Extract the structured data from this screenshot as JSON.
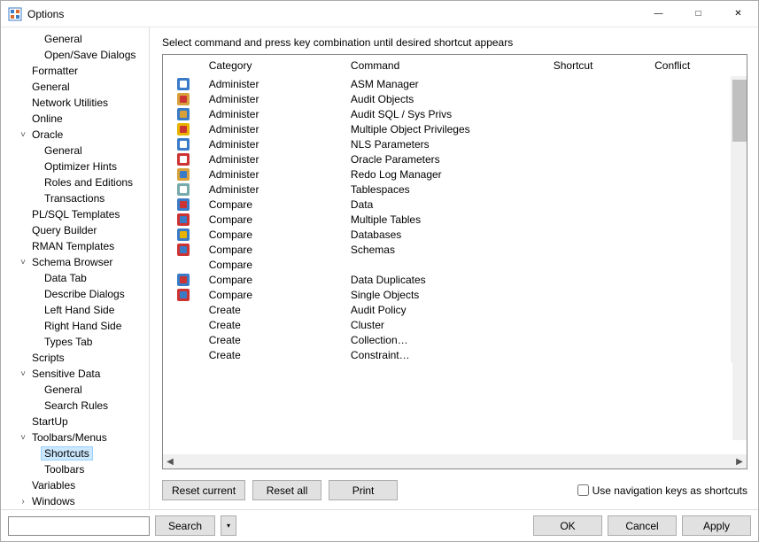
{
  "window": {
    "title": "Options"
  },
  "instruction": "Select command and press key combination until desired shortcut appears",
  "columns": {
    "category": "Category",
    "command": "Command",
    "shortcut": "Shortcut",
    "conflict": "Conflict"
  },
  "rows": [
    {
      "category": "Administer",
      "command": "ASM Manager",
      "icon": "asm"
    },
    {
      "category": "Administer",
      "command": "Audit Objects",
      "icon": "audit"
    },
    {
      "category": "Administer",
      "command": "Audit SQL / Sys Privs",
      "icon": "auditsql"
    },
    {
      "category": "Administer",
      "command": "Multiple Object Privileges",
      "icon": "star"
    },
    {
      "category": "Administer",
      "command": "NLS Parameters",
      "icon": "nls"
    },
    {
      "category": "Administer",
      "command": "Oracle Parameters",
      "icon": "ora"
    },
    {
      "category": "Administer",
      "command": "Redo Log Manager",
      "icon": "redo"
    },
    {
      "category": "Administer",
      "command": "Tablespaces",
      "icon": "ts"
    },
    {
      "category": "Compare",
      "command": "Data",
      "icon": "cmp"
    },
    {
      "category": "Compare",
      "command": "Multiple Tables",
      "icon": "cmp2"
    },
    {
      "category": "Compare",
      "command": "Databases",
      "icon": "cmpdb"
    },
    {
      "category": "Compare",
      "command": "Schemas",
      "icon": "cmps"
    },
    {
      "category": "Compare",
      "command": "",
      "icon": ""
    },
    {
      "category": "Compare",
      "command": "Data Duplicates",
      "icon": "dup"
    },
    {
      "category": "Compare",
      "command": "Single Objects",
      "icon": "single"
    },
    {
      "category": "Create",
      "command": "Audit Policy",
      "icon": ""
    },
    {
      "category": "Create",
      "command": "Cluster",
      "icon": ""
    },
    {
      "category": "Create",
      "command": "Collection…",
      "icon": ""
    },
    {
      "category": "Create",
      "command": "Constraint…",
      "icon": ""
    }
  ],
  "tree": [
    {
      "label": "General",
      "level": 2
    },
    {
      "label": "Open/Save Dialogs",
      "level": 2
    },
    {
      "label": "Formatter",
      "level": 1
    },
    {
      "label": "General",
      "level": 1
    },
    {
      "label": "Network Utilities",
      "level": 1
    },
    {
      "label": "Online",
      "level": 1
    },
    {
      "label": "Oracle",
      "level": 1,
      "exp": true
    },
    {
      "label": "General",
      "level": 2
    },
    {
      "label": "Optimizer Hints",
      "level": 2
    },
    {
      "label": "Roles and Editions",
      "level": 2
    },
    {
      "label": "Transactions",
      "level": 2
    },
    {
      "label": "PL/SQL Templates",
      "level": 1
    },
    {
      "label": "Query Builder",
      "level": 1
    },
    {
      "label": "RMAN Templates",
      "level": 1
    },
    {
      "label": "Schema Browser",
      "level": 1,
      "exp": true
    },
    {
      "label": "Data Tab",
      "level": 2
    },
    {
      "label": "Describe Dialogs",
      "level": 2
    },
    {
      "label": "Left Hand Side",
      "level": 2
    },
    {
      "label": "Right Hand Side",
      "level": 2
    },
    {
      "label": "Types Tab",
      "level": 2
    },
    {
      "label": "Scripts",
      "level": 1
    },
    {
      "label": "Sensitive Data",
      "level": 1,
      "exp": true
    },
    {
      "label": "General",
      "level": 2
    },
    {
      "label": "Search Rules",
      "level": 2
    },
    {
      "label": "StartUp",
      "level": 1
    },
    {
      "label": "Toolbars/Menus",
      "level": 1,
      "exp": true
    },
    {
      "label": "Shortcuts",
      "level": 2,
      "selected": true
    },
    {
      "label": "Toolbars",
      "level": 2
    },
    {
      "label": "Variables",
      "level": 1
    },
    {
      "label": "Windows",
      "level": 1,
      "more": true
    }
  ],
  "buttons": {
    "reset_current": "Reset current",
    "reset_all": "Reset all",
    "print": "Print",
    "nav_shortcuts": "Use navigation keys as shortcuts",
    "search": "Search",
    "ok": "OK",
    "cancel": "Cancel",
    "apply": "Apply"
  }
}
